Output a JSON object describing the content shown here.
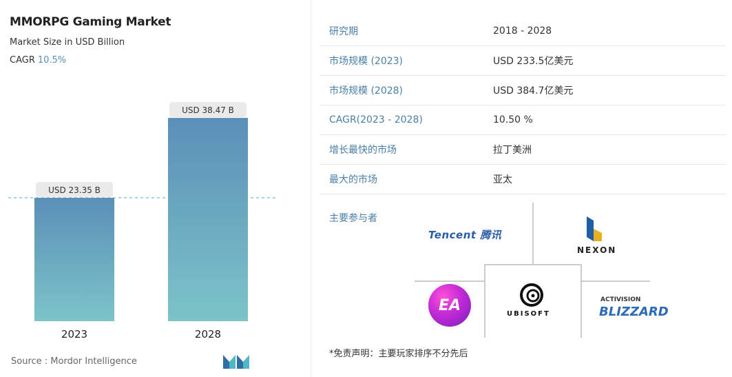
{
  "chart_data": {
    "type": "bar",
    "title": "MMORPG Gaming Market",
    "subtitle": "Market Size in USD Billion",
    "cagr_label": "CAGR",
    "cagr_value": "10.5%",
    "categories": [
      "2023",
      "2028"
    ],
    "values": [
      23.35,
      38.47
    ],
    "data_labels": [
      "USD 23.35 B",
      "USD 38.47 B"
    ],
    "ylim": [
      0,
      42
    ],
    "grid": false,
    "colors": {
      "bar_top": "#5b8fb8",
      "bar_bottom": "#7cc4c8",
      "dashed_line": "#8fc6d8"
    }
  },
  "source": "Source :  Mordor Intelligence",
  "info_table": [
    {
      "key": "研究期",
      "value": "2018 - 2028"
    },
    {
      "key": "市场规模 (2023)",
      "value": "USD 233.5亿美元"
    },
    {
      "key": "市场规模 (2028)",
      "value": "USD 384.7亿美元"
    },
    {
      "key": "CAGR(2023 - 2028)",
      "value": "10.50 %"
    },
    {
      "key": "增长最快的市场",
      "value": "拉丁美洲"
    },
    {
      "key": "最大的市场",
      "value": "亚太"
    }
  ],
  "players_label": "主要参与者",
  "players": {
    "tencent": "Tencent 腾讯",
    "nexon": "NEXON",
    "ea": "EA",
    "ubisoft": "UBISOFT",
    "activision": "ACTIVISION",
    "blizzard": "BLIZZARD"
  },
  "disclaimer": "*免责声明：主要玩家排序不分先后",
  "icons": [
    "mordor-logo-icon",
    "nexon-logo-icon",
    "ubisoft-swirl-icon"
  ]
}
